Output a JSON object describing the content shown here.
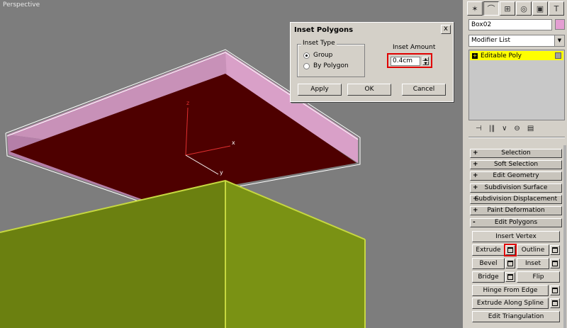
{
  "viewport": {
    "label": "Perspective",
    "axes": {
      "x": "x",
      "y": "y",
      "z": "z"
    }
  },
  "dialog": {
    "title": "Inset Polygons",
    "close": "x",
    "inset_type": {
      "legend": "Inset Type",
      "options": [
        "Group",
        "By Polygon"
      ],
      "selected": "Group"
    },
    "inset_amount": {
      "label": "Inset Amount",
      "value": "0.4cm"
    },
    "buttons": {
      "apply": "Apply",
      "ok": "OK",
      "cancel": "Cancel"
    }
  },
  "panel": {
    "tabs": [
      "create-icon",
      "modify-icon",
      "hierarchy-icon",
      "motion-icon",
      "display-icon",
      "utilities-icon"
    ],
    "object_name": "Box02",
    "object_color": "#e49ed2",
    "modifier_list": "Modifier List",
    "stack_item": "Editable Poly",
    "rollouts": [
      {
        "sign": "+",
        "label": "Selection"
      },
      {
        "sign": "+",
        "label": "Soft Selection"
      },
      {
        "sign": "+",
        "label": "Edit Geometry"
      },
      {
        "sign": "+",
        "label": "Subdivision Surface"
      },
      {
        "sign": "+",
        "label": "Subdivision Displacement"
      },
      {
        "sign": "+",
        "label": "Paint Deformation"
      },
      {
        "sign": "-",
        "label": "Edit Polygons"
      }
    ],
    "edit_polygons": {
      "insert_vertex": "Insert Vertex",
      "extrude": "Extrude",
      "outline": "Outline",
      "bevel": "Bevel",
      "inset": "Inset",
      "bridge": "Bridge",
      "flip": "Flip",
      "hinge": "Hinge From Edge",
      "extrude_spline": "Extrude Along Spline",
      "edit_triangulation": "Edit Triangulation"
    }
  }
}
